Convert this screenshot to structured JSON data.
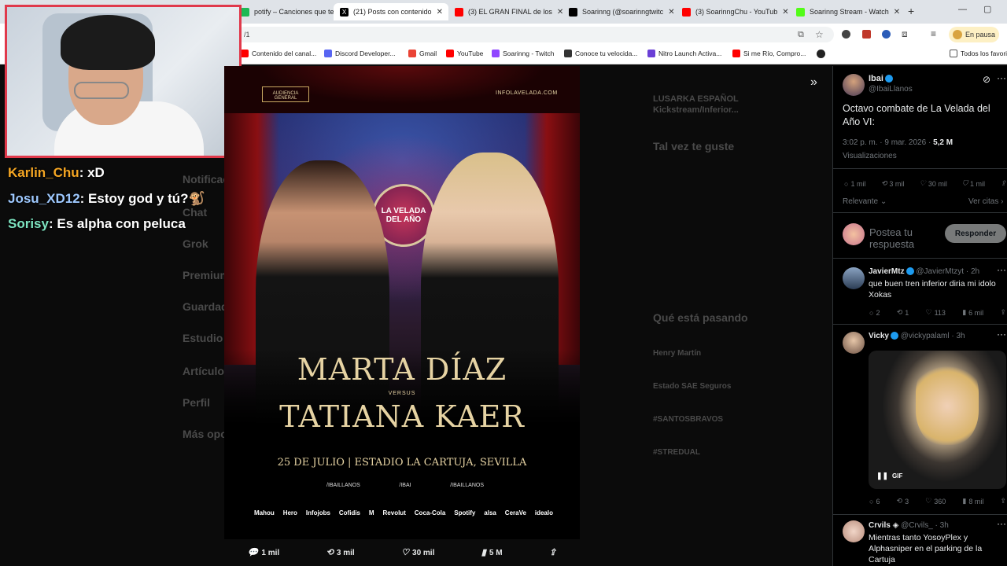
{
  "tabs": [
    {
      "label": "potify – Canciones que te",
      "color": "#1db954"
    },
    {
      "label": "(21) Posts con contenido",
      "color": "#000000",
      "active": true
    },
    {
      "label": "(3) EL GRAN FINAL de los",
      "color": "#ff0000"
    },
    {
      "label": "Soarinng (@soarinngtwitc",
      "color": "#000000"
    },
    {
      "label": "(3) SoarinngChu - YouTub",
      "color": "#ff0000"
    },
    {
      "label": "Soarinng Stream - Watch",
      "color": "#53fc18"
    }
  ],
  "address": {
    "url": "/1",
    "profile_label": "En pausa"
  },
  "bookmarks": [
    {
      "label": "Contenido del canal...",
      "color": "#ff0000"
    },
    {
      "label": "Discord Developer...",
      "color": "#5865f2"
    },
    {
      "label": "Gmail",
      "color": "#ea4335"
    },
    {
      "label": "YouTube",
      "color": "#ff0000"
    },
    {
      "label": "Soarinng - Twitch",
      "color": "#9146ff"
    },
    {
      "label": "Conoce tu velocida...",
      "color": "#333333"
    },
    {
      "label": "Nitro Launch Activa...",
      "color": "#6a3fd6"
    },
    {
      "label": "Si me Río, Compro...",
      "color": "#ff0000"
    },
    {
      "label": "Todos los favoritos",
      "color": "#555555"
    }
  ],
  "chat": [
    {
      "user": "Karlin_Chu",
      "color": "#f5a623",
      "message": ": xD"
    },
    {
      "user": "Josu_XD12",
      "color": "#9ec9ff",
      "message": ": Estoy god y tú?🐒"
    },
    {
      "user": "Sorisy",
      "color": "#7de3c0",
      "message": ": Es alpha con peluca"
    }
  ],
  "poster": {
    "top_left": "AUDIENCIA GENERAL",
    "top_right": "INFOLAVELADA.COM",
    "badge": "LA VELADA DEL AÑO",
    "name1": "MARTA DÍAZ",
    "versus": "VERSUS",
    "name2": "TATIANA KAER",
    "date_venue": "25 DE JULIO | ESTADIO LA CARTUJA, SEVILLA",
    "socials": [
      "/IBAILLANOS",
      "/IBAI",
      "/IBAILLANOS"
    ],
    "sponsors": [
      "Mahou",
      "Hero",
      "Infojobs",
      "Cofidis",
      "M",
      "Revolut",
      "Coca-Cola",
      "Spotify",
      "alsa",
      "CeraVe",
      "idealo"
    ]
  },
  "post_stats": {
    "replies": "1 mil",
    "reposts": "3 mil",
    "likes": "30 mil",
    "views": "5 M"
  },
  "background_ghost": {
    "trend_location": "LUSARKA ESPAÑOL",
    "trend_sub": "Kickstream/Inferior...",
    "may_like": "Tal vez te guste",
    "whats_happening": "Qué está pasando",
    "left_nav": [
      "Notificaciones",
      "Chat",
      "Grok",
      "Premium",
      "Guardados",
      "Estudio",
      "Artículos",
      "Perfil",
      "Más opciones"
    ],
    "trends": [
      "Henry Martín",
      "Estado SAE Seguros",
      "#SANTOSBRAVOS",
      "#STREDUAL"
    ]
  },
  "tweet": {
    "author": "Ibai",
    "handle": "@IbaiLlanos",
    "text": "Octavo combate de La Velada del Año VI:",
    "time": "3:02 p. m. · 9 mar. 2026 ·",
    "views": "5,2 M",
    "views_label": "Visualizaciones",
    "replies": "1 mil",
    "reposts": "3 mil",
    "likes": "30 mil",
    "bookmarks": "1 mil",
    "sort_label": "Relevante",
    "quotes_label": "Ver citas",
    "reply_placeholder": "Postea tu respuesta",
    "reply_button": "Responder"
  },
  "replies": [
    {
      "author": "JavierMtz",
      "handle": "@JavierMtzyt · 2h",
      "text": "que buen tren inferior diria mi idolo Xokas",
      "replies": "2",
      "reposts": "1",
      "likes": "113",
      "views": "6 mil"
    },
    {
      "author": "Vicky",
      "handle": "@vickypalaml · 3h",
      "text": "",
      "gif_label": "GIF",
      "replies": "6",
      "reposts": "3",
      "likes": "360",
      "views": "8 mil"
    },
    {
      "author": "Crvils",
      "handle": "@Crvils_ · 3h",
      "text": "Mientras tanto YosoyPlex y Alphasniper en el parking de la Cartuja",
      "replies": "",
      "reposts": "",
      "likes": "",
      "views": ""
    }
  ]
}
